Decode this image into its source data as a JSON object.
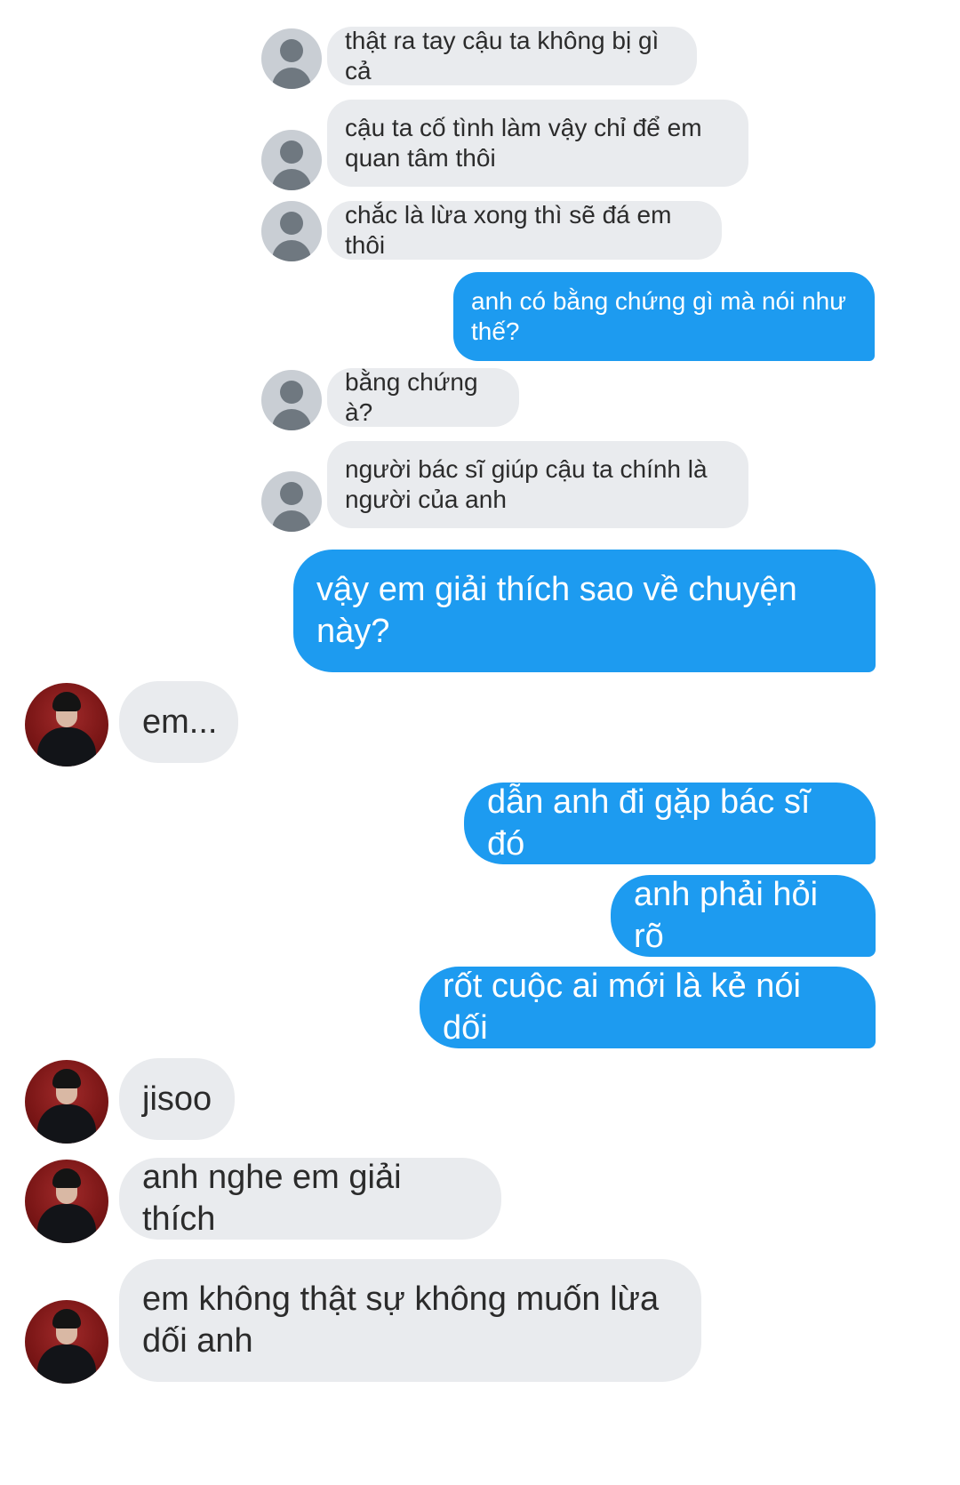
{
  "messages": [
    {
      "side": "in",
      "avatar": "default-avatar",
      "text": "thật ra tay cậu ta không bị gì cả"
    },
    {
      "side": "in",
      "avatar": "default-avatar",
      "text": "cậu ta cố tình làm vậy chỉ để em\nquan tâm thôi"
    },
    {
      "side": "in",
      "avatar": "default-avatar",
      "text": "chắc là lừa xong thì sẽ đá em thôi"
    },
    {
      "side": "out",
      "text": "anh có bằng chứng gì mà nói như\nthế?"
    },
    {
      "side": "in",
      "avatar": "default-avatar",
      "text": "bằng chứng à?"
    },
    {
      "side": "in",
      "avatar": "default-avatar",
      "text": "người bác sĩ giúp cậu ta chính là\nngười của anh"
    },
    {
      "side": "out",
      "text": "vậy em giải thích sao về chuyện\nnày?"
    },
    {
      "side": "in",
      "avatar": "photo-avatar",
      "text": "em..."
    },
    {
      "side": "out",
      "text": "dẫn anh đi gặp bác sĩ đó"
    },
    {
      "side": "out",
      "text": "anh phải hỏi rõ"
    },
    {
      "side": "out",
      "text": "rốt cuộc ai mới là kẻ nói dối"
    },
    {
      "side": "in",
      "avatar": "photo-avatar",
      "text": "jisoo"
    },
    {
      "side": "in",
      "avatar": "photo-avatar",
      "text": "anh nghe em giải thích"
    },
    {
      "side": "in",
      "avatar": "photo-avatar",
      "text": "em không thật sự không muốn lừa\ndối anh"
    }
  ],
  "colors": {
    "outgoing_bubble": "#1d9bf0",
    "incoming_bubble": "#e9ebee",
    "default_avatar": "#c9ced4"
  }
}
